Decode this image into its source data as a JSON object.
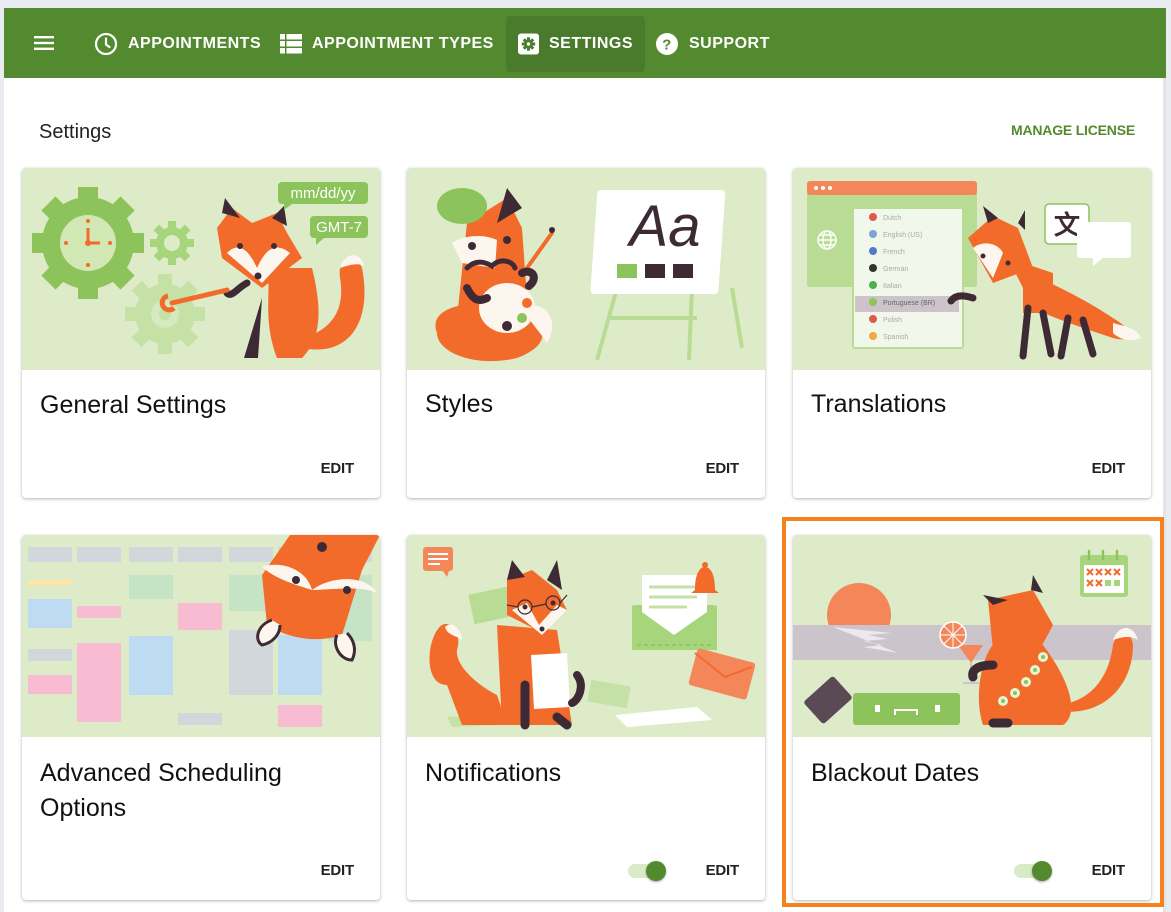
{
  "topbar": {
    "menu_icon": "hamburger-menu-icon",
    "nav": [
      {
        "label": "APPOINTMENTS",
        "icon": "clock-icon",
        "active": false
      },
      {
        "label": "APPOINTMENT TYPES",
        "icon": "list-icon",
        "active": false
      },
      {
        "label": "SETTINGS",
        "icon": "gear-icon",
        "active": true
      },
      {
        "label": "SUPPORT",
        "icon": "help-circle-icon",
        "active": false
      }
    ]
  },
  "page": {
    "title": "Settings",
    "manage_license": "MANAGE LICENSE"
  },
  "cards": [
    {
      "title": "General Settings",
      "edit": "EDIT",
      "illustration": {
        "bubble1": "mm/dd/yy",
        "bubble2": "GMT-7"
      }
    },
    {
      "title": "Styles",
      "edit": "EDIT",
      "illustration": {
        "easel_text": "Aa"
      }
    },
    {
      "title": "Translations",
      "edit": "EDIT",
      "illustration": {
        "languages": [
          "Dutch",
          "English (US)",
          "French",
          "German",
          "Italian",
          "Portuguese (BR)",
          "Polish",
          "Spanish"
        ],
        "selected": "Portuguese (BR)",
        "glyph": "文"
      }
    },
    {
      "title": "Advanced Scheduling Options",
      "title_line1": "Advanced Scheduling",
      "title_line2": "Options",
      "edit": "EDIT"
    },
    {
      "title": "Notifications",
      "edit": "EDIT",
      "toggle_on": true
    },
    {
      "title": "Blackout Dates",
      "edit": "EDIT",
      "toggle_on": true,
      "highlighted": true
    }
  ],
  "colors": {
    "brand_green": "#548a2f",
    "active_nav": "#4a7a2b",
    "card_art_bg": "#deebc8",
    "highlight_orange": "#f6821f",
    "fox_orange": "#f26b2a"
  }
}
